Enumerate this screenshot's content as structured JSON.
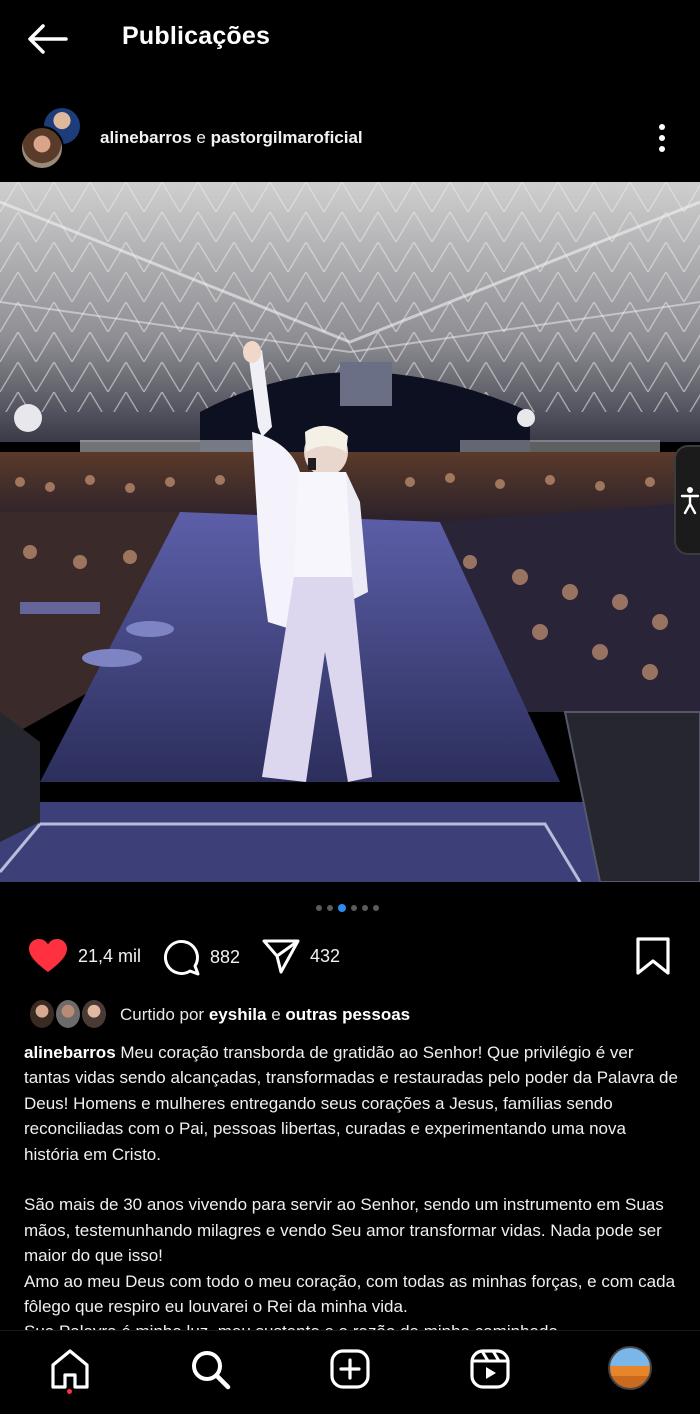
{
  "header": {
    "title": "Publicações",
    "back_icon": "arrow-left-icon"
  },
  "post": {
    "author_primary": "alinebarros",
    "author_joiner": " e ",
    "author_secondary": "pastorgilmaroficial",
    "more_icon": "kebab-menu-icon",
    "carousel": {
      "count": 6,
      "active_index": 2
    },
    "likes": "21,4 mil",
    "comments": "882",
    "shares": "432",
    "liked_by_prefix": "Curtido por ",
    "liked_by_user": "eyshila",
    "liked_by_suffix": " e ",
    "liked_by_others": "outras pessoas",
    "caption_user": "alinebarros",
    "caption_p1": " Meu coração transborda de gratidão ao Senhor! Que privilégio é ver tantas vidas sendo alcançadas, transformadas e restauradas pelo poder da Palavra de Deus! Homens e mulheres entregando seus corações a Jesus, famílias sendo reconciliadas com o Pai, pessoas libertas, curadas e experimentando uma nova história em Cristo.",
    "caption_p2": "São mais de 30 anos vivendo para servir ao Senhor, sendo um instrumento em Suas mãos, testemunhando milagres e vendo Seu amor transformar vidas. Nada pode ser maior do que isso!",
    "caption_p3": "Amo ao meu Deus com todo o meu coração, com todas as minhas forças, e com cada fôlego que respiro eu louvarei o Rei da minha vida.",
    "caption_p4": "Sua Palavra é minha luz, meu sustento e a razão da minha caminhada."
  },
  "colors": {
    "background": "#000000",
    "like_red": "#ff3040",
    "dot_active": "#2d8cf0"
  },
  "nav": {
    "items": [
      "home-icon",
      "search-icon",
      "create-icon",
      "reels-icon",
      "profile-avatar"
    ],
    "active": "home-icon"
  }
}
